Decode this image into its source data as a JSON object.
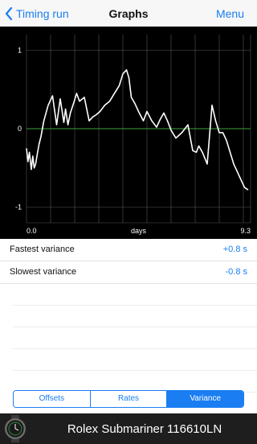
{
  "nav": {
    "back_label": "Timing run",
    "title": "Graphs",
    "menu_label": "Menu"
  },
  "chart_data": {
    "type": "line",
    "xlabel": "days",
    "x_tick_labels": [
      "0.0",
      "9.3"
    ],
    "xlim": [
      0.0,
      9.3
    ],
    "ylim": [
      -1.2,
      1.2
    ],
    "y_ticks": [
      1,
      0,
      -1
    ],
    "grid": true,
    "series": [
      {
        "x": [
          0.0,
          0.06,
          0.12,
          0.2,
          0.26,
          0.32,
          0.38,
          0.46,
          0.52,
          0.6,
          0.72,
          0.9,
          1.08,
          1.25,
          1.4,
          1.55,
          1.62,
          1.72,
          1.82,
          1.95,
          2.08,
          2.2,
          2.4,
          2.6,
          2.75,
          2.9,
          3.05,
          3.25,
          3.45,
          3.65,
          3.85,
          4.0,
          4.15,
          4.25,
          4.35,
          4.5,
          4.65,
          4.85,
          5.0,
          5.2,
          5.4,
          5.55,
          5.7,
          5.85,
          6.0,
          6.2,
          6.45,
          6.7,
          6.9,
          7.05,
          7.15,
          7.3,
          7.5,
          7.7,
          7.85,
          8.0,
          8.15,
          8.3,
          8.45,
          8.6,
          8.75,
          8.9,
          9.05,
          9.2
        ],
        "y": [
          -0.25,
          -0.42,
          -0.3,
          -0.52,
          -0.35,
          -0.5,
          -0.45,
          -0.3,
          -0.2,
          -0.1,
          0.1,
          0.3,
          0.42,
          0.05,
          0.38,
          0.08,
          0.25,
          0.05,
          0.2,
          0.32,
          0.45,
          0.35,
          0.4,
          0.1,
          0.15,
          0.18,
          0.22,
          0.3,
          0.35,
          0.45,
          0.55,
          0.7,
          0.75,
          0.65,
          0.4,
          0.32,
          0.22,
          0.1,
          0.22,
          0.1,
          0.02,
          0.12,
          0.2,
          0.1,
          -0.02,
          -0.12,
          -0.05,
          0.05,
          -0.28,
          -0.3,
          -0.22,
          -0.3,
          -0.45,
          0.3,
          0.1,
          -0.05,
          -0.05,
          -0.15,
          -0.3,
          -0.45,
          -0.55,
          -0.65,
          -0.75,
          -0.78
        ]
      }
    ],
    "line_color": "#ffffff",
    "zero_line_color": "#3aa23a",
    "grid_color": "#555555"
  },
  "stats": {
    "fastest_label": "Fastest variance",
    "fastest_value": "+0.8 s",
    "slowest_label": "Slowest variance",
    "slowest_value": "-0.8 s"
  },
  "tabs": [
    "Offsets",
    "Rates",
    "Variance"
  ],
  "active_tab": "Variance",
  "footer": {
    "title": "Rolex Submariner 116610LN"
  },
  "colors": {
    "accent": "#1a7ef2",
    "chart_bg": "#000000",
    "footer_bg": "#1e1e1e"
  }
}
